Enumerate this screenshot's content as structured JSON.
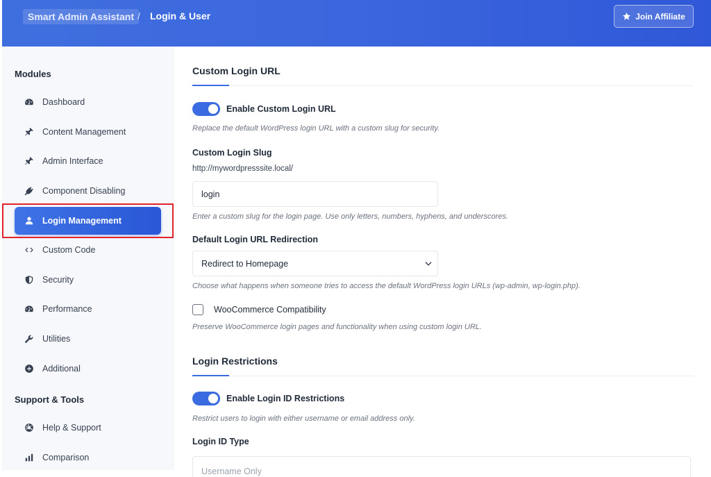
{
  "header": {
    "brand": "Smart Admin Assistant",
    "separator": "/",
    "current": "Login & User",
    "join_label": "Join Affiliate",
    "join_icon": "star-icon"
  },
  "sidebar": {
    "modules_title": "Modules",
    "items": [
      {
        "label": "Dashboard",
        "icon": "gauge-icon"
      },
      {
        "label": "Content Management",
        "icon": "pin-icon"
      },
      {
        "label": "Admin Interface",
        "icon": "pin-icon"
      },
      {
        "label": "Component Disabling",
        "icon": "plug-icon"
      },
      {
        "label": "Login Management",
        "icon": "user-icon",
        "active": true
      },
      {
        "label": "Custom Code",
        "icon": "code-icon"
      },
      {
        "label": "Security",
        "icon": "shield-icon"
      },
      {
        "label": "Performance",
        "icon": "gauge-icon"
      },
      {
        "label": "Utilities",
        "icon": "wrench-icon"
      },
      {
        "label": "Additional",
        "icon": "plus-circle-icon"
      }
    ],
    "support_title": "Support & Tools",
    "support_items": [
      {
        "label": "Help & Support",
        "icon": "lifebuoy-icon"
      },
      {
        "label": "Comparison",
        "icon": "bar-chart-icon"
      }
    ]
  },
  "main": {
    "custom_login": {
      "title": "Custom Login URL",
      "enable_label": "Enable Custom Login URL",
      "enable_on": true,
      "enable_desc": "Replace the default WordPress login URL with a custom slug for security.",
      "slug_label": "Custom Login Slug",
      "base_url": "http://mywordpresssite.local/",
      "slug_value": "login",
      "slug_desc": "Enter a custom slug for the login page. Use only letters, numbers, hyphens, and underscores.",
      "redirect_label": "Default Login URL Redirection",
      "redirect_value": "Redirect to Homepage",
      "redirect_desc": "Choose what happens when someone tries to access the default WordPress login URLs (wp-admin, wp-login.php).",
      "woo_label": "WooCommerce Compatibility",
      "woo_checked": false,
      "woo_desc": "Preserve WooCommerce login pages and functionality when using custom login URL."
    },
    "restrictions": {
      "title": "Login Restrictions",
      "enable_label": "Enable Login ID Restrictions",
      "enable_on": true,
      "enable_desc": "Restrict users to login with either username or email address only.",
      "type_label": "Login ID Type",
      "type_value": "Username Only"
    }
  },
  "colors": {
    "accent": "#3b6be0",
    "highlight": "#e0242a"
  }
}
